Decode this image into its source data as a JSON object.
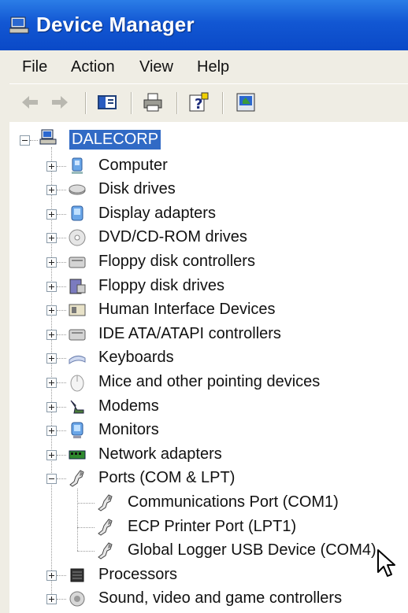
{
  "window": {
    "title": "Device Manager"
  },
  "menu": [
    "File",
    "Action",
    "View",
    "Help"
  ],
  "toolbar": [
    "back-icon",
    "forward-icon",
    "show-hide-console-tree-icon",
    "print-icon",
    "help-icon",
    "properties-icon"
  ],
  "tree": {
    "root": "DALECORP",
    "categories": [
      {
        "label": "Computer",
        "icon": "computer-icon"
      },
      {
        "label": "Disk drives",
        "icon": "disk-drive-icon"
      },
      {
        "label": "Display adapters",
        "icon": "display-adapter-icon"
      },
      {
        "label": "DVD/CD-ROM drives",
        "icon": "dvd-drive-icon"
      },
      {
        "label": "Floppy disk controllers",
        "icon": "floppy-controller-icon"
      },
      {
        "label": "Floppy disk drives",
        "icon": "floppy-drive-icon"
      },
      {
        "label": "Human Interface Devices",
        "icon": "hid-icon"
      },
      {
        "label": "IDE ATA/ATAPI controllers",
        "icon": "ide-controller-icon"
      },
      {
        "label": "Keyboards",
        "icon": "keyboard-icon"
      },
      {
        "label": "Mice and other pointing devices",
        "icon": "mouse-icon"
      },
      {
        "label": "Modems",
        "icon": "modem-icon"
      },
      {
        "label": "Monitors",
        "icon": "monitor-icon"
      },
      {
        "label": "Network adapters",
        "icon": "network-adapter-icon"
      },
      {
        "label": "Ports (COM & LPT)",
        "icon": "port-icon",
        "expanded": true,
        "children": [
          {
            "label": "Communications Port (COM1)",
            "icon": "port-icon"
          },
          {
            "label": "ECP Printer Port (LPT1)",
            "icon": "port-icon"
          },
          {
            "label": "Global Logger USB Device (COM4)",
            "icon": "port-icon"
          }
        ]
      },
      {
        "label": "Processors",
        "icon": "processor-icon"
      },
      {
        "label": "Sound, video and game controllers",
        "icon": "sound-icon"
      }
    ]
  },
  "colors": {
    "titlebar": "#0a49c7",
    "selection": "#316ac5",
    "chrome": "#efede4"
  }
}
